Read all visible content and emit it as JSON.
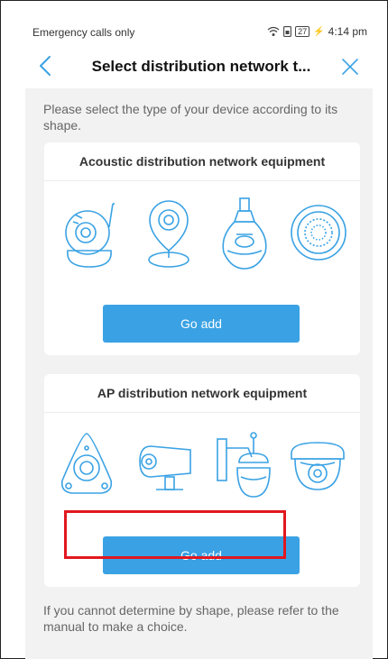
{
  "status": {
    "left": "Emergency calls only",
    "battery": "27",
    "time": "4:14 pm"
  },
  "nav": {
    "title": "Select distribution network t...",
    "back_icon": "chevron-left-icon",
    "close_icon": "close-icon"
  },
  "intro": "Please select the type of your device according to its shape.",
  "sections": [
    {
      "title": "Acoustic distribution network equipment",
      "button": "Go add",
      "devices": [
        "pan-tilt-camera-icon",
        "wall-mount-camera-icon",
        "bulb-camera-icon",
        "round-camera-icon"
      ]
    },
    {
      "title": "AP distribution network equipment",
      "button": "Go add",
      "devices": [
        "fisheye-camera-icon",
        "bullet-camera-icon",
        "ptz-dome-camera-icon",
        "dome-camera-icon"
      ]
    }
  ],
  "footer": "If you cannot determine by shape, please refer to the manual to make a choice.",
  "colors": {
    "accent": "#3aa2e4",
    "highlight": "#e1171f",
    "background": "#f2f2f2"
  }
}
